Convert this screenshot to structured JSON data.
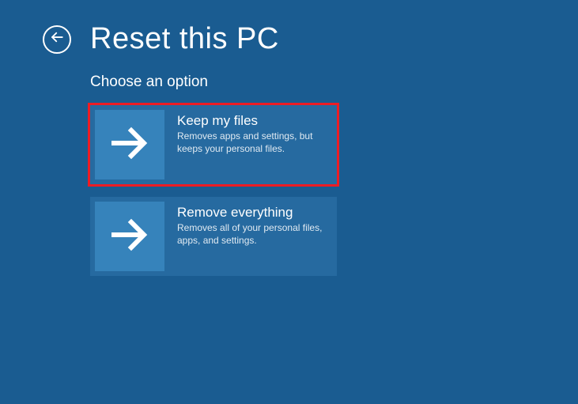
{
  "header": {
    "title": "Reset this PC"
  },
  "content": {
    "subtitle": "Choose an option",
    "options": [
      {
        "title": "Keep my files",
        "description": "Removes apps and settings, but keeps your personal files.",
        "highlighted": true
      },
      {
        "title": "Remove everything",
        "description": "Removes all of your personal files, apps, and settings.",
        "highlighted": false
      }
    ]
  }
}
